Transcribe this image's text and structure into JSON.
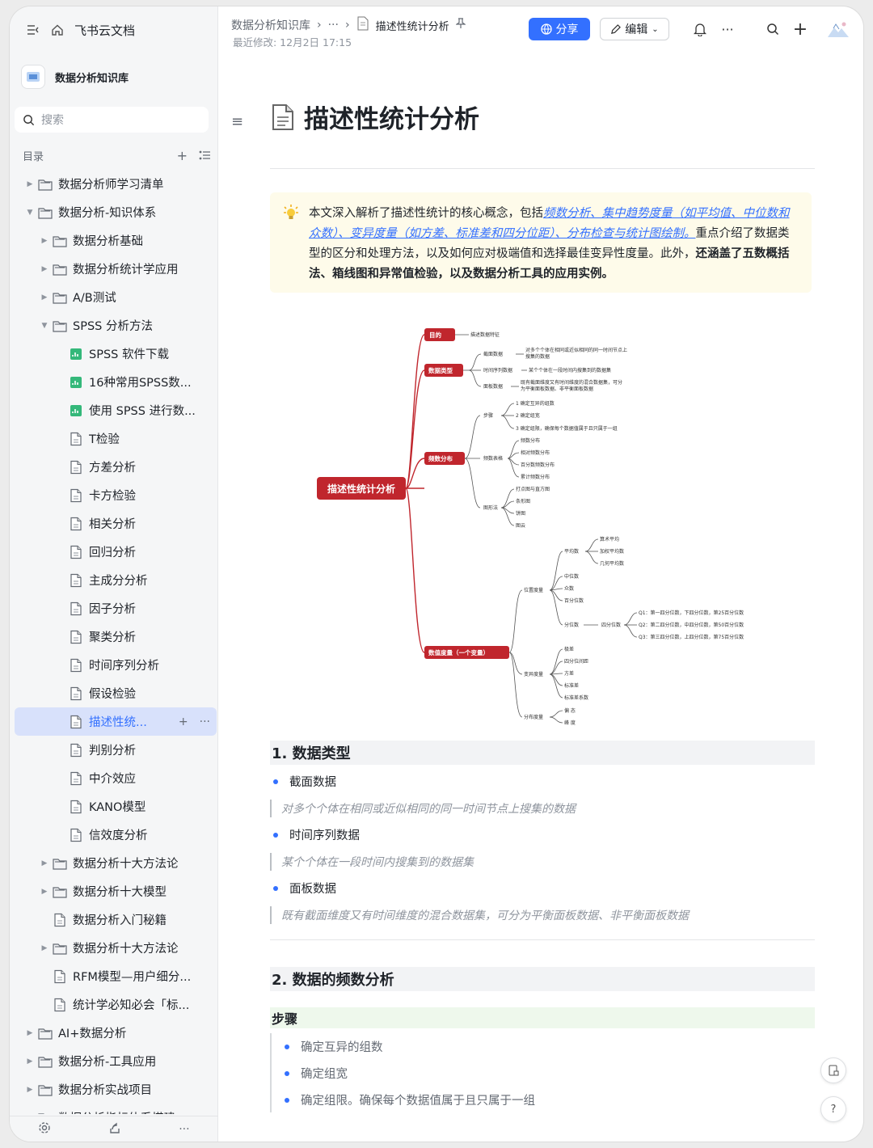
{
  "sidebar": {
    "app_name": "飞书云文档",
    "space_name": "数据分析知识库",
    "search_placeholder": "搜索",
    "toc_label": "目录",
    "items": [
      {
        "label": "数据分析师学习清单",
        "level": 0,
        "arrow": "right",
        "icon": "folder"
      },
      {
        "label": "数据分析-知识体系",
        "level": 0,
        "arrow": "down",
        "icon": "folder"
      },
      {
        "label": "数据分析基础",
        "level": 1,
        "arrow": "right",
        "icon": "folder"
      },
      {
        "label": "数据分析统计学应用",
        "level": 1,
        "arrow": "right",
        "icon": "folder"
      },
      {
        "label": "A/B测试",
        "level": 1,
        "arrow": "right",
        "icon": "folder"
      },
      {
        "label": "SPSS 分析方法",
        "level": 1,
        "arrow": "down",
        "icon": "folder"
      },
      {
        "label": "SPSS 软件下载",
        "level": 2,
        "arrow": "",
        "icon": "sheet"
      },
      {
        "label": "16种常用SPSS数...",
        "level": 2,
        "arrow": "",
        "icon": "sheet"
      },
      {
        "label": "使用 SPSS 进行数...",
        "level": 2,
        "arrow": "",
        "icon": "sheet"
      },
      {
        "label": "T检验",
        "level": 2,
        "arrow": "",
        "icon": "doc"
      },
      {
        "label": "方差分析",
        "level": 2,
        "arrow": "",
        "icon": "doc"
      },
      {
        "label": "卡方检验",
        "level": 2,
        "arrow": "",
        "icon": "doc"
      },
      {
        "label": "相关分析",
        "level": 2,
        "arrow": "",
        "icon": "doc"
      },
      {
        "label": "回归分析",
        "level": 2,
        "arrow": "",
        "icon": "doc"
      },
      {
        "label": "主成分分析",
        "level": 2,
        "arrow": "",
        "icon": "doc"
      },
      {
        "label": "因子分析",
        "level": 2,
        "arrow": "",
        "icon": "doc"
      },
      {
        "label": "聚类分析",
        "level": 2,
        "arrow": "",
        "icon": "doc"
      },
      {
        "label": "时间序列分析",
        "level": 2,
        "arrow": "",
        "icon": "doc"
      },
      {
        "label": "假设检验",
        "level": 2,
        "arrow": "",
        "icon": "doc"
      },
      {
        "label": "描述性统...",
        "level": 2,
        "arrow": "",
        "icon": "doc",
        "active": true
      },
      {
        "label": "判别分析",
        "level": 2,
        "arrow": "",
        "icon": "doc"
      },
      {
        "label": "中介效应",
        "level": 2,
        "arrow": "",
        "icon": "doc"
      },
      {
        "label": "KANO模型",
        "level": 2,
        "arrow": "",
        "icon": "doc"
      },
      {
        "label": "信效度分析",
        "level": 2,
        "arrow": "",
        "icon": "doc"
      },
      {
        "label": "数据分析十大方法论",
        "level": 1,
        "arrow": "right",
        "icon": "folder"
      },
      {
        "label": "数据分析十大模型",
        "level": 1,
        "arrow": "right",
        "icon": "folder"
      },
      {
        "label": "数据分析入门秘籍",
        "level": 1,
        "arrow": "",
        "icon": "doc"
      },
      {
        "label": "数据分析十大方法论",
        "level": 1,
        "arrow": "right",
        "icon": "folder"
      },
      {
        "label": "RFM模型—用户细分...",
        "level": 1,
        "arrow": "",
        "icon": "doc"
      },
      {
        "label": "统计学必知必会「标...",
        "level": 1,
        "arrow": "",
        "icon": "doc"
      },
      {
        "label": "AI+数据分析",
        "level": 0,
        "arrow": "right",
        "icon": "folder"
      },
      {
        "label": "数据分析-工具应用",
        "level": 0,
        "arrow": "right",
        "icon": "folder"
      },
      {
        "label": "数据分析实战项目",
        "level": 0,
        "arrow": "right",
        "icon": "folder"
      },
      {
        "label": "数据分析指标体系搭建",
        "level": 0,
        "arrow": "right",
        "icon": "folder"
      }
    ]
  },
  "header": {
    "breadcrumb_root": "数据分析知识库",
    "breadcrumb_ellipsis": "···",
    "breadcrumb_current": "描述性统计分析",
    "last_modified": "最近修改: 12月2日 17:15",
    "share_label": "分享",
    "edit_label": "编辑"
  },
  "doc": {
    "title": "描述性统计分析",
    "summary": {
      "text1": "本文深入解析了描述性统计的核心概念，包括",
      "link": "频数分析、集中趋势度量（如平均值、中位数和众数）、变异度量（如方差、标准差和四分位距）、分布检查与统计图绘制。",
      "text2": "重点介绍了数据类型的区分和处理方法，以及如何应对极端值和选择最佳变异性度量。此外，",
      "bold": "还涵盖了五数概括法、箱线图和异常值检验，以及数据分析工具的应用实例。"
    },
    "mindmap": {
      "root": "描述性统计分析",
      "b_purpose": "目的",
      "purpose_leaf": "描述数据特征",
      "b_types": "数据类型",
      "t1": "截面数据",
      "t1d_a": "对多个个体在相同或近似相同的同一时间节点上",
      "t1d_b": "搜集的数据",
      "t2": "时间序列数据",
      "t2d": "某个个体在一段时间内搜集到的数据集",
      "t3": "面板数据",
      "t3d_a": "既有截面维度又有时间维度的混合数据集，可分",
      "t3d_b": "为平衡面板数据、非平衡面板数据",
      "b_freq": "频数分布",
      "f_steps": "步骤",
      "s1": "1 确定互异的组数",
      "s2": "2 确定组宽",
      "s3": "3 确定组限，确保每个数据值属于且只属于一组",
      "f_table": "频数表格",
      "ft1": "频数分布",
      "ft2": "相对频数分布",
      "ft3": "百分数频数分布",
      "ft4": "累计频数分布",
      "f_chart": "图形法",
      "fc1": "打点图与直方图",
      "fc2": "条形图",
      "fc3": "饼图",
      "fc4": "图云",
      "b_measure": "数值度量（一个变量）",
      "m_pos": "位置度量",
      "p_mean": "平均数",
      "pm1": "算术平均",
      "pm2": "加权平均数",
      "pm3": "几何平均数",
      "p2": "中位数",
      "p3": "众数",
      "p4": "百分位数",
      "p5": "分位数",
      "p5a": "四分位数",
      "q1": "Q1：第一四分位数，下四分位数，第25百分位数",
      "q2": "Q2：第二四分位数，中四分位数，第50百分位数",
      "q3": "Q3：第三四分位数，上四分位数，第75百分位数",
      "m_var": "变异度量",
      "v1": "极差",
      "v2": "四分位间距",
      "v3": "方差",
      "v4": "标准差",
      "v5": "标准差系数",
      "m_dist": "分布度量",
      "d1": "偏 态",
      "d2": "峰 度"
    },
    "sec1_title": "1. 数据类型",
    "sec1_items": [
      {
        "label": "截面数据",
        "quote": "对多个个体在相同或近似相同的同一时间节点上搜集的数据"
      },
      {
        "label": "时间序列数据",
        "quote": "某个个体在一段时间内搜集到的数据集"
      },
      {
        "label": "面板数据",
        "quote": "既有截面维度又有时间维度的混合数据集，可分为平衡面板数据、非平衡面板数据"
      }
    ],
    "sec2_title": "2. 数据的频数分析",
    "steps_title": "步骤",
    "steps": [
      "确定互异的组数",
      "确定组宽",
      "确定组限。确保每个数据值属于且只属于一组"
    ]
  },
  "colors": {
    "accent": "#3370ff",
    "mindmap_red": "#c0262d",
    "callout_bg": "#fefbea"
  }
}
